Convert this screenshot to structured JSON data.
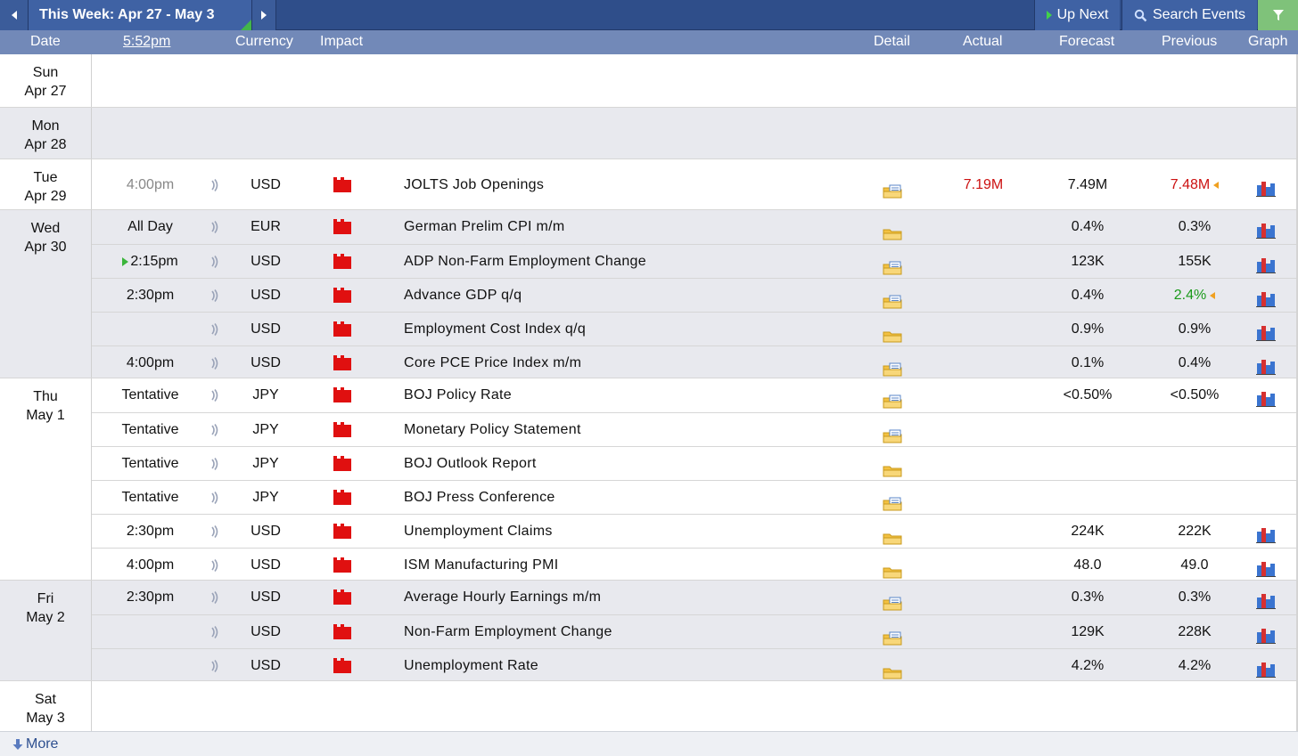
{
  "toolbar": {
    "week_title": "This Week: Apr 27 - May 3",
    "up_next_label": "Up Next",
    "search_label": "Search Events"
  },
  "header": {
    "date": "Date",
    "time": "5:52pm",
    "currency": "Currency",
    "impact": "Impact",
    "detail": "Detail",
    "actual": "Actual",
    "forecast": "Forecast",
    "previous": "Previous",
    "graph": "Graph"
  },
  "days": [
    {
      "day": "Sun",
      "date": "Apr 27"
    },
    {
      "day": "Mon",
      "date": "Apr 28"
    },
    {
      "day": "Tue",
      "date": "Apr 29"
    },
    {
      "day": "Wed",
      "date": "Apr 30"
    },
    {
      "day": "Thu",
      "date": "May 1"
    },
    {
      "day": "Fri",
      "date": "May 2"
    },
    {
      "day": "Sat",
      "date": "May 3"
    }
  ],
  "events": [
    {
      "time": "4:00pm",
      "currency": "USD",
      "event": "JOLTS Job Openings",
      "actual": "7.19M",
      "forecast": "7.49M",
      "previous": "7.48M"
    },
    {
      "time": "All Day",
      "currency": "EUR",
      "event": "German Prelim CPI m/m",
      "actual": "",
      "forecast": "0.4%",
      "previous": "0.3%"
    },
    {
      "time": "2:15pm",
      "currency": "USD",
      "event": "ADP Non-Farm Employment Change",
      "actual": "",
      "forecast": "123K",
      "previous": "155K"
    },
    {
      "time": "2:30pm",
      "currency": "USD",
      "event": "Advance GDP q/q",
      "actual": "",
      "forecast": "0.4%",
      "previous": "2.4%"
    },
    {
      "time": "",
      "currency": "USD",
      "event": "Employment Cost Index q/q",
      "actual": "",
      "forecast": "0.9%",
      "previous": "0.9%"
    },
    {
      "time": "4:00pm",
      "currency": "USD",
      "event": "Core PCE Price Index m/m",
      "actual": "",
      "forecast": "0.1%",
      "previous": "0.4%"
    },
    {
      "time": "Tentative",
      "currency": "JPY",
      "event": "BOJ Policy Rate",
      "actual": "",
      "forecast": "<0.50%",
      "previous": "<0.50%"
    },
    {
      "time": "Tentative",
      "currency": "JPY",
      "event": "Monetary Policy Statement",
      "actual": "",
      "forecast": "",
      "previous": ""
    },
    {
      "time": "Tentative",
      "currency": "JPY",
      "event": "BOJ Outlook Report",
      "actual": "",
      "forecast": "",
      "previous": ""
    },
    {
      "time": "Tentative",
      "currency": "JPY",
      "event": "BOJ Press Conference",
      "actual": "",
      "forecast": "",
      "previous": ""
    },
    {
      "time": "2:30pm",
      "currency": "USD",
      "event": "Unemployment Claims",
      "actual": "",
      "forecast": "224K",
      "previous": "222K"
    },
    {
      "time": "4:00pm",
      "currency": "USD",
      "event": "ISM Manufacturing PMI",
      "actual": "",
      "forecast": "48.0",
      "previous": "49.0"
    },
    {
      "time": "2:30pm",
      "currency": "USD",
      "event": "Average Hourly Earnings m/m",
      "actual": "",
      "forecast": "0.3%",
      "previous": "0.3%"
    },
    {
      "time": "",
      "currency": "USD",
      "event": "Non-Farm Employment Change",
      "actual": "",
      "forecast": "129K",
      "previous": "228K"
    },
    {
      "time": "",
      "currency": "USD",
      "event": "Unemployment Rate",
      "actual": "",
      "forecast": "4.2%",
      "previous": "4.2%"
    }
  ],
  "footer": {
    "more_label": "More"
  },
  "colors": {
    "toolbar": "#2f4e8a",
    "header": "#7289b8",
    "stripe": "#e8e9ee",
    "actual_worse": "#cc1111",
    "previous_revised_up": "#1a9a1a",
    "impact_high": "#e01010"
  },
  "icons": {
    "impact": "red-folder-icon",
    "sound": "sound-wave-icon",
    "detail": "folder-icon",
    "graph": "bar-graph-icon",
    "more": "arrow-down-icon"
  }
}
